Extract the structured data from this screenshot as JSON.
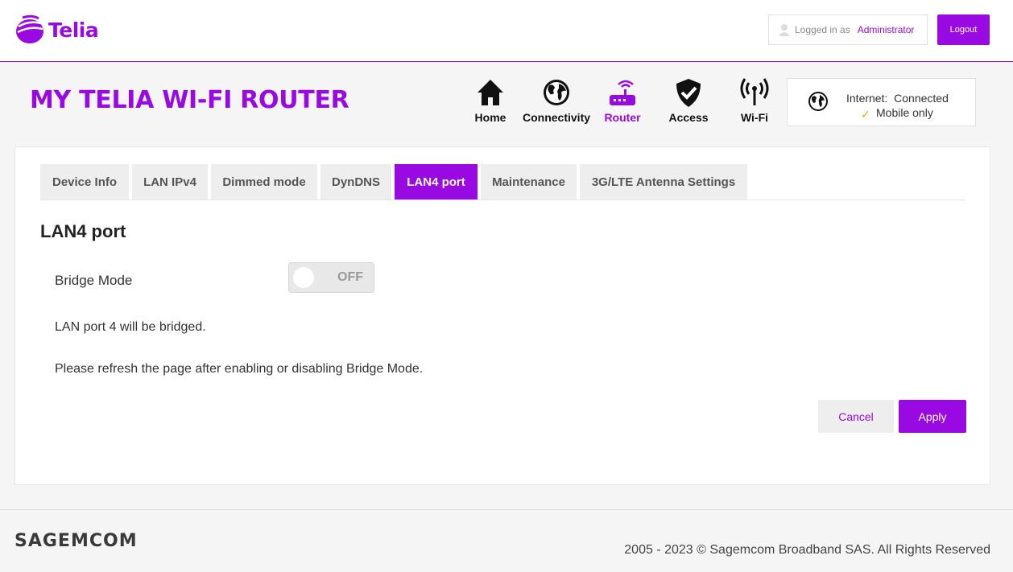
{
  "brand": {
    "logo_text": "Telia",
    "accent_color": "#990ae3"
  },
  "user": {
    "logged_in_label": "Logged in as",
    "username": "Administrator",
    "logout_label": "Logout"
  },
  "header": {
    "title": "MY TELIA WI-FI ROUTER"
  },
  "nav": {
    "items": [
      {
        "label": "Home",
        "icon": "home-icon"
      },
      {
        "label": "Connectivity",
        "icon": "globe-icon"
      },
      {
        "label": "Router",
        "icon": "router-icon"
      },
      {
        "label": "Access",
        "icon": "shield-icon"
      },
      {
        "label": "Wi-Fi",
        "icon": "wifi-icon"
      }
    ],
    "active": "Router"
  },
  "status": {
    "internet_label": "Internet:",
    "internet_value": "Connected",
    "mode": "Mobile only",
    "icon": "globe-icon"
  },
  "tabs": {
    "items": [
      {
        "label": "Device Info"
      },
      {
        "label": "LAN IPv4"
      },
      {
        "label": "Dimmed mode"
      },
      {
        "label": "DynDNS"
      },
      {
        "label": "LAN4 port"
      },
      {
        "label": "Maintenance"
      },
      {
        "label": "3G/LTE Antenna Settings"
      }
    ],
    "active": "LAN4 port"
  },
  "content": {
    "title": "LAN4 port",
    "bridge_label": "Bridge Mode",
    "bridge_state": "OFF",
    "info1": "LAN port 4 will be bridged.",
    "info2": "Please refresh the page after enabling or disabling Bridge Mode."
  },
  "actions": {
    "cancel_label": "Cancel",
    "apply_label": "Apply"
  },
  "footer": {
    "logo_text": "SAGEMCOM",
    "copyright": "2005 - 2023 © Sagemcom Broadband SAS. All Rights Reserved"
  }
}
